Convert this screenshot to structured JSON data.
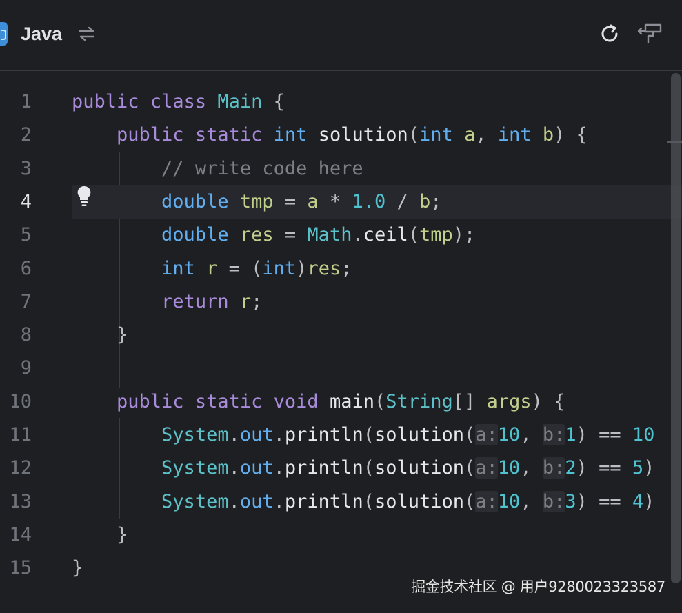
{
  "header": {
    "language": "Java",
    "icons": [
      "java-lang-icon",
      "swap-icon",
      "refresh-icon",
      "format-icon"
    ]
  },
  "editor": {
    "current_line": 4,
    "lines": [
      {
        "n": "1",
        "tokens": [
          [
            "kw",
            "public"
          ],
          [
            "pl",
            " "
          ],
          [
            "kw",
            "class"
          ],
          [
            "pl",
            " "
          ],
          [
            "cl",
            "Main"
          ],
          [
            "pl",
            " {"
          ]
        ]
      },
      {
        "n": "2",
        "tokens": [
          [
            "pl",
            "    "
          ],
          [
            "kw",
            "public"
          ],
          [
            "pl",
            " "
          ],
          [
            "kw",
            "static"
          ],
          [
            "pl",
            " "
          ],
          [
            "ty",
            "int"
          ],
          [
            "pl",
            " "
          ],
          [
            "fn",
            "solution"
          ],
          [
            "pl",
            "("
          ],
          [
            "ty",
            "int"
          ],
          [
            "pl",
            " "
          ],
          [
            "va",
            "a"
          ],
          [
            "pl",
            ", "
          ],
          [
            "ty",
            "int"
          ],
          [
            "pl",
            " "
          ],
          [
            "va",
            "b"
          ],
          [
            "pl",
            ") {"
          ]
        ]
      },
      {
        "n": "3",
        "tokens": [
          [
            "pl",
            "        "
          ],
          [
            "cm",
            "// write code here"
          ]
        ]
      },
      {
        "n": "4",
        "tokens": [
          [
            "pl",
            "        "
          ],
          [
            "ty",
            "double"
          ],
          [
            "pl",
            " "
          ],
          [
            "va",
            "tmp"
          ],
          [
            "pl",
            " = "
          ],
          [
            "va",
            "a"
          ],
          [
            "pl",
            " * "
          ],
          [
            "nu",
            "1.0"
          ],
          [
            "pl",
            " / "
          ],
          [
            "va",
            "b"
          ],
          [
            "pl",
            ";"
          ]
        ]
      },
      {
        "n": "5",
        "tokens": [
          [
            "pl",
            "        "
          ],
          [
            "ty",
            "double"
          ],
          [
            "pl",
            " "
          ],
          [
            "va",
            "res"
          ],
          [
            "pl",
            " = "
          ],
          [
            "cl",
            "Math"
          ],
          [
            "pl",
            "."
          ],
          [
            "fn",
            "ceil"
          ],
          [
            "pl",
            "("
          ],
          [
            "va",
            "tmp"
          ],
          [
            "pl",
            ");"
          ]
        ]
      },
      {
        "n": "6",
        "tokens": [
          [
            "pl",
            "        "
          ],
          [
            "ty",
            "int"
          ],
          [
            "pl",
            " "
          ],
          [
            "va",
            "r"
          ],
          [
            "pl",
            " = ("
          ],
          [
            "ty",
            "int"
          ],
          [
            "pl",
            ")"
          ],
          [
            "va",
            "res"
          ],
          [
            "pl",
            ";"
          ]
        ]
      },
      {
        "n": "7",
        "tokens": [
          [
            "pl",
            "        "
          ],
          [
            "kw",
            "return"
          ],
          [
            "pl",
            " "
          ],
          [
            "va",
            "r"
          ],
          [
            "pl",
            ";"
          ]
        ]
      },
      {
        "n": "8",
        "tokens": [
          [
            "pl",
            "    }"
          ]
        ]
      },
      {
        "n": "9",
        "tokens": []
      },
      {
        "n": "10",
        "tokens": [
          [
            "pl",
            "    "
          ],
          [
            "kw",
            "public"
          ],
          [
            "pl",
            " "
          ],
          [
            "kw",
            "static"
          ],
          [
            "pl",
            " "
          ],
          [
            "kw",
            "void"
          ],
          [
            "pl",
            " "
          ],
          [
            "fn",
            "main"
          ],
          [
            "pl",
            "("
          ],
          [
            "cl",
            "String"
          ],
          [
            "pl",
            "[] "
          ],
          [
            "va",
            "args"
          ],
          [
            "pl",
            ") {"
          ]
        ]
      },
      {
        "n": "11",
        "tokens": [
          [
            "pl",
            "        "
          ],
          [
            "cl",
            "System"
          ],
          [
            "pl",
            "."
          ],
          [
            "ty",
            "out"
          ],
          [
            "pl",
            "."
          ],
          [
            "fn",
            "println"
          ],
          [
            "pl",
            "("
          ],
          [
            "fn",
            "solution"
          ],
          [
            "pl",
            "("
          ],
          [
            "hint",
            "a:"
          ],
          [
            "nu",
            "10"
          ],
          [
            "pl",
            ", "
          ],
          [
            "hint",
            "b:"
          ],
          [
            "nu",
            "1"
          ],
          [
            "pl",
            ") == "
          ],
          [
            "nu",
            "10"
          ]
        ]
      },
      {
        "n": "12",
        "tokens": [
          [
            "pl",
            "        "
          ],
          [
            "cl",
            "System"
          ],
          [
            "pl",
            "."
          ],
          [
            "ty",
            "out"
          ],
          [
            "pl",
            "."
          ],
          [
            "fn",
            "println"
          ],
          [
            "pl",
            "("
          ],
          [
            "fn",
            "solution"
          ],
          [
            "pl",
            "("
          ],
          [
            "hint",
            "a:"
          ],
          [
            "nu",
            "10"
          ],
          [
            "pl",
            ", "
          ],
          [
            "hint",
            "b:"
          ],
          [
            "nu",
            "2"
          ],
          [
            "pl",
            ") == "
          ],
          [
            "nu",
            "5"
          ],
          [
            "pl",
            ")"
          ]
        ]
      },
      {
        "n": "13",
        "tokens": [
          [
            "pl",
            "        "
          ],
          [
            "cl",
            "System"
          ],
          [
            "pl",
            "."
          ],
          [
            "ty",
            "out"
          ],
          [
            "pl",
            "."
          ],
          [
            "fn",
            "println"
          ],
          [
            "pl",
            "("
          ],
          [
            "fn",
            "solution"
          ],
          [
            "pl",
            "("
          ],
          [
            "hint",
            "a:"
          ],
          [
            "nu",
            "10"
          ],
          [
            "pl",
            ", "
          ],
          [
            "hint",
            "b:"
          ],
          [
            "nu",
            "3"
          ],
          [
            "pl",
            ") == "
          ],
          [
            "nu",
            "4"
          ],
          [
            "pl",
            ")"
          ]
        ]
      },
      {
        "n": "14",
        "tokens": [
          [
            "pl",
            "    }"
          ]
        ]
      },
      {
        "n": "15",
        "tokens": [
          [
            "pl",
            "}"
          ]
        ]
      }
    ]
  },
  "watermark": "掘金技术社区 @ 用户9280023323587",
  "colors": {
    "background": "#1e1f22",
    "keyword": "#a98bdc",
    "type": "#61aff0",
    "class": "#5cc1c8",
    "number": "#4fc3d0",
    "variable": "#c0d08c",
    "comment": "#7c7f86"
  }
}
